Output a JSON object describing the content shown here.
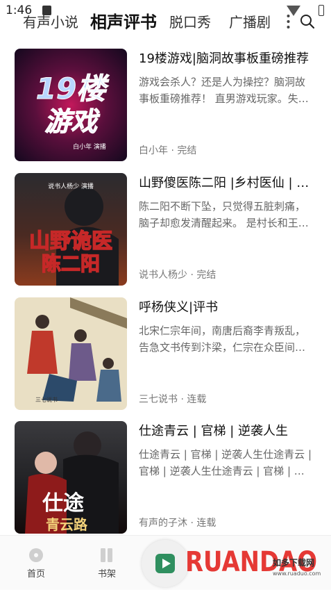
{
  "status_bar": {
    "time": "1:46"
  },
  "tabs": [
    {
      "label": "有声小说",
      "active": false
    },
    {
      "label": "相声评书",
      "active": true
    },
    {
      "label": "脱口秀",
      "active": false
    },
    {
      "label": "广播剧",
      "active": false
    }
  ],
  "items": [
    {
      "title": "19楼游戏|脑洞故事板重磅推荐",
      "desc": "游戏会杀人？还是人为操控？脑洞故事板重磅推荐！ 直男游戏玩家。失…",
      "meta": "白小年 · 完结",
      "cover_text": [
        "19楼",
        "游戏"
      ],
      "cover_caption": "白小年 演播"
    },
    {
      "title": "山野傻医陈二阳 |乡村医仙 | 【…",
      "desc": "陈二阳不断下坠，只觉得五脏刺痛，脑子却愈发清醒起来。 是村长和王…",
      "meta": "说书人杨少 · 完结",
      "cover_text": [
        "山野诡医",
        "陈二阳"
      ],
      "cover_caption": "说书人杨少 演播"
    },
    {
      "title": "呼杨侠义|评书",
      "desc": "北宋仁宗年间，南唐后裔李青叛乱，告急文书传到汴梁，仁宗在众臣间…",
      "meta": "三七说书 · 连载",
      "cover_caption": "三七说书"
    },
    {
      "title": "仕途青云 | 官梯 | 逆袭人生",
      "desc": "仕途青云 | 官梯 | 逆袭人生仕途青云 | 官梯 | 逆袭人生仕途青云 | 官梯 | …",
      "meta": "有声的子沐 · 连载",
      "cover_text": [
        "仕途",
        "青云路"
      ]
    }
  ],
  "bottom_nav": {
    "home_label": "首页",
    "shelf_label": "书架"
  },
  "watermark": {
    "brand": "RUANDAO",
    "cn": "如多下载网",
    "url": "www.ruaduo.com"
  },
  "colors": {
    "accent": "#2f8f5f",
    "title": "#111111",
    "desc": "#666666"
  }
}
